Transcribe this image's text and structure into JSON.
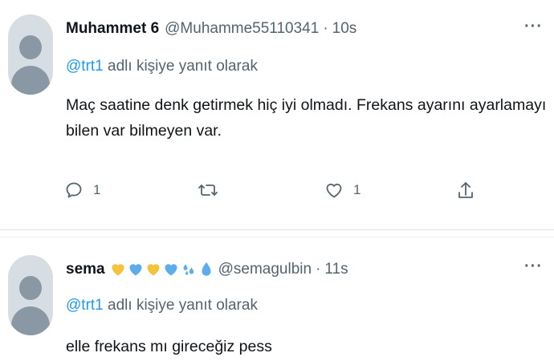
{
  "tweets": [
    {
      "name": "Muhammet 6",
      "handle": "@Muhamme55110341",
      "time": "10s",
      "more": "···",
      "reply_handle": "@trt1",
      "reply_text": " adlı kişiye yanıt olarak",
      "text": "Maç saatine denk getirmek hiç iyi olmadı. Frekans ayarını ayarlamayı bilen var bilmeyen var.",
      "reply_count": "1",
      "like_count": "1"
    },
    {
      "name": "sema",
      "handle": "@semagulbin",
      "time": "11s",
      "more": "···",
      "reply_handle": "@trt1",
      "reply_text": " adlı kişiye yanıt olarak",
      "text": "elle frekans mı gireceğiz pess",
      "emojis": [
        "yellow-heart",
        "blue-heart",
        "yellow-heart",
        "blue-heart",
        "sweat-droplets",
        "droplet"
      ]
    }
  ],
  "colors": {
    "link": "#1d9bf0",
    "secondary": "#536471",
    "yellow_heart": "#f5c33b",
    "blue_heart": "#5dadec"
  }
}
